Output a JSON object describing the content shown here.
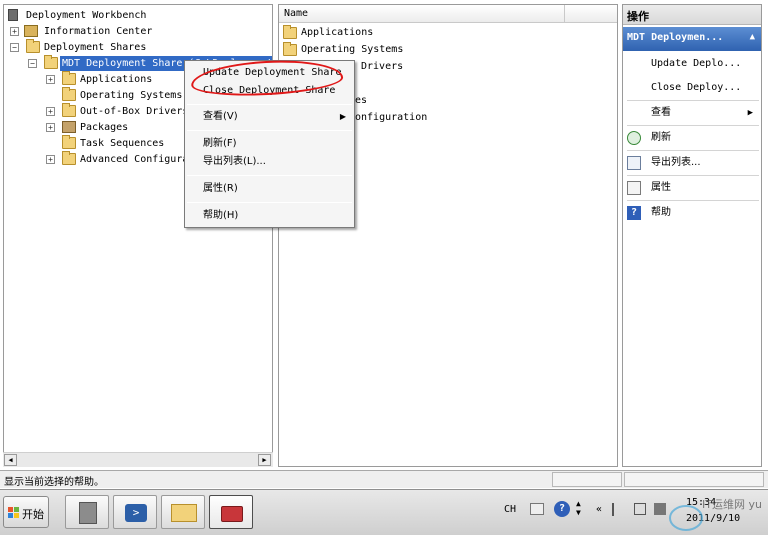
{
  "tree": {
    "root": "Deployment Workbench",
    "information_center": "Information Center",
    "deployment_shares": "Deployment Shares",
    "mdt_share": "MDT Deployment Share (C:\\DeploymentS",
    "children": [
      "Applications",
      "Operating Systems",
      "Out-of-Box Drivers",
      "Packages",
      "Task Sequences",
      "Advanced Configura"
    ]
  },
  "list": {
    "column_name": "Name",
    "rows": [
      "Applications",
      "Operating Systems",
      "Drivers",
      "",
      "nces",
      "onfiguration"
    ]
  },
  "actions": {
    "title": "操作",
    "section": "MDT Deploymen...",
    "items": [
      "Update Deplo...",
      "Close Deploy...",
      "查看",
      "刷新",
      "导出列表...",
      "属性",
      "帮助"
    ]
  },
  "context_menu": {
    "items": [
      "Update Deployment Share",
      "Close Deployment Share",
      "查看(V)",
      "刷新(F)",
      "导出列表(L)...",
      "属性(R)",
      "帮助(H)"
    ]
  },
  "status": {
    "text": "显示当前选择的帮助。"
  },
  "taskbar": {
    "start": "开始",
    "lang": "CH",
    "clock_time": "15:34",
    "clock_date": "2011/9/10",
    "watermark": "IT运维网 yunv.com"
  },
  "colors": {
    "selection": "#316ac5",
    "annotation": "#e01818",
    "actions_header": "#2f62b0"
  }
}
